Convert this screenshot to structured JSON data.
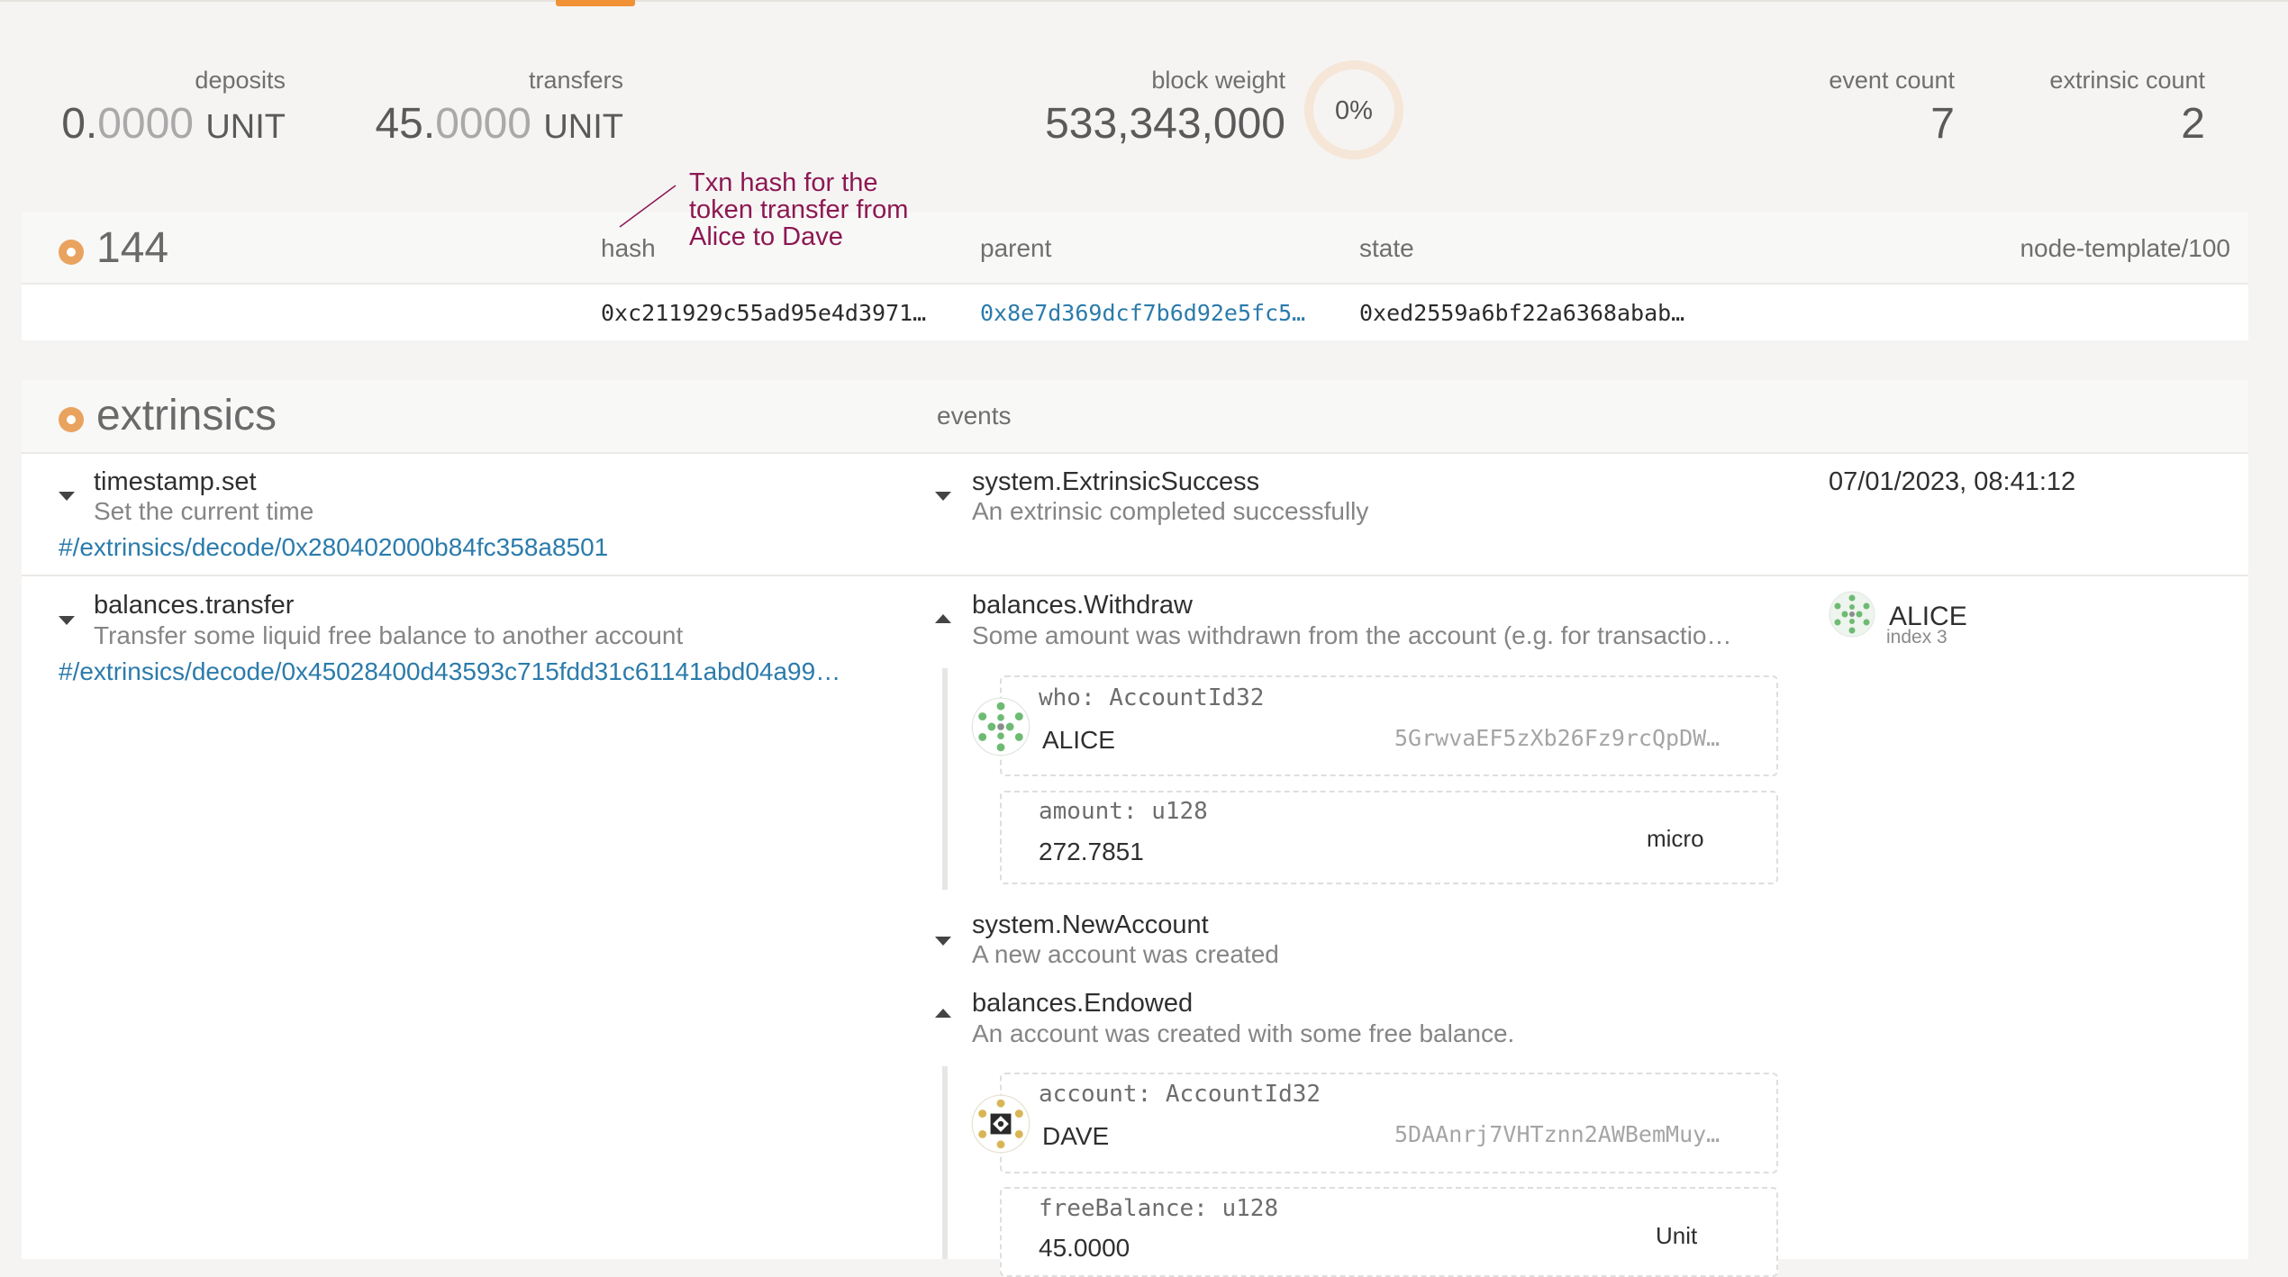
{
  "summary": {
    "deposits": {
      "label": "deposits",
      "int": "0.",
      "frac": "0000",
      "unit": "UNIT"
    },
    "transfers": {
      "label": "transfers",
      "int": "45.",
      "frac": "0000",
      "unit": "UNIT"
    },
    "block_weight": {
      "label": "block weight",
      "value": "533,343,000",
      "percent": "0%"
    },
    "event_count": {
      "label": "event count",
      "value": "7"
    },
    "extrinsic_count": {
      "label": "extrinsic count",
      "value": "2"
    }
  },
  "annotation": {
    "line1": "Txn hash for the",
    "line2": "token transfer from",
    "line3": "Alice to Dave"
  },
  "block": {
    "number": "144",
    "hash_label": "hash",
    "parent_label": "parent",
    "state_label": "state",
    "runtime": "node-template/100",
    "hash": "0xc211929c55ad95e4d3971…",
    "parent": "0x8e7d369dcf7b6d92e5fc5…",
    "state": "0xed2559a6bf22a6368abab…"
  },
  "extrinsics": {
    "title": "extrinsics",
    "events_label": "events",
    "items": [
      {
        "name": "timestamp.set",
        "desc": "Set the current time",
        "link": "#/extrinsics/decode/0x280402000b84fc358a8501",
        "time": "07/01/2023, 08:41:12",
        "events": [
          {
            "name": "system.ExtrinsicSuccess",
            "desc": "An extrinsic completed successfully"
          }
        ]
      },
      {
        "name": "balances.transfer",
        "desc": "Transfer some liquid free balance to another account",
        "link": "#/extrinsics/decode/0x45028400d43593c715fdd31c61141abd04a99…",
        "signer": {
          "name": "ALICE",
          "index": "index 3"
        },
        "events": [
          {
            "name": "balances.Withdraw",
            "desc": "Some amount was withdrawn from the account (e.g. for transactio…",
            "params": [
              {
                "label": "who: AccountId32",
                "name": "ALICE",
                "address": "5GrwvaEF5zXb26Fz9rcQpDW…"
              },
              {
                "label": "amount: u128",
                "value": "272.7851",
                "unit": "micro"
              }
            ]
          },
          {
            "name": "system.NewAccount",
            "desc": "A new account was created"
          },
          {
            "name": "balances.Endowed",
            "desc": "An account was created with some free balance.",
            "params": [
              {
                "label": "account: AccountId32",
                "name": "DAVE",
                "address": "5DAAnrj7VHTznn2AWBemMuy…"
              },
              {
                "label": "freeBalance: u128",
                "value": "45.0000",
                "unit": "Unit"
              }
            ]
          }
        ]
      }
    ]
  },
  "colors": {
    "accent": "#f19135",
    "link": "#2b7bab",
    "annotation": "#8d1852",
    "dot": "#e9a35f"
  },
  "icons": [
    "caret-down-icon",
    "caret-up-icon",
    "identicon-alice",
    "identicon-dave",
    "section-dot-icon"
  ]
}
